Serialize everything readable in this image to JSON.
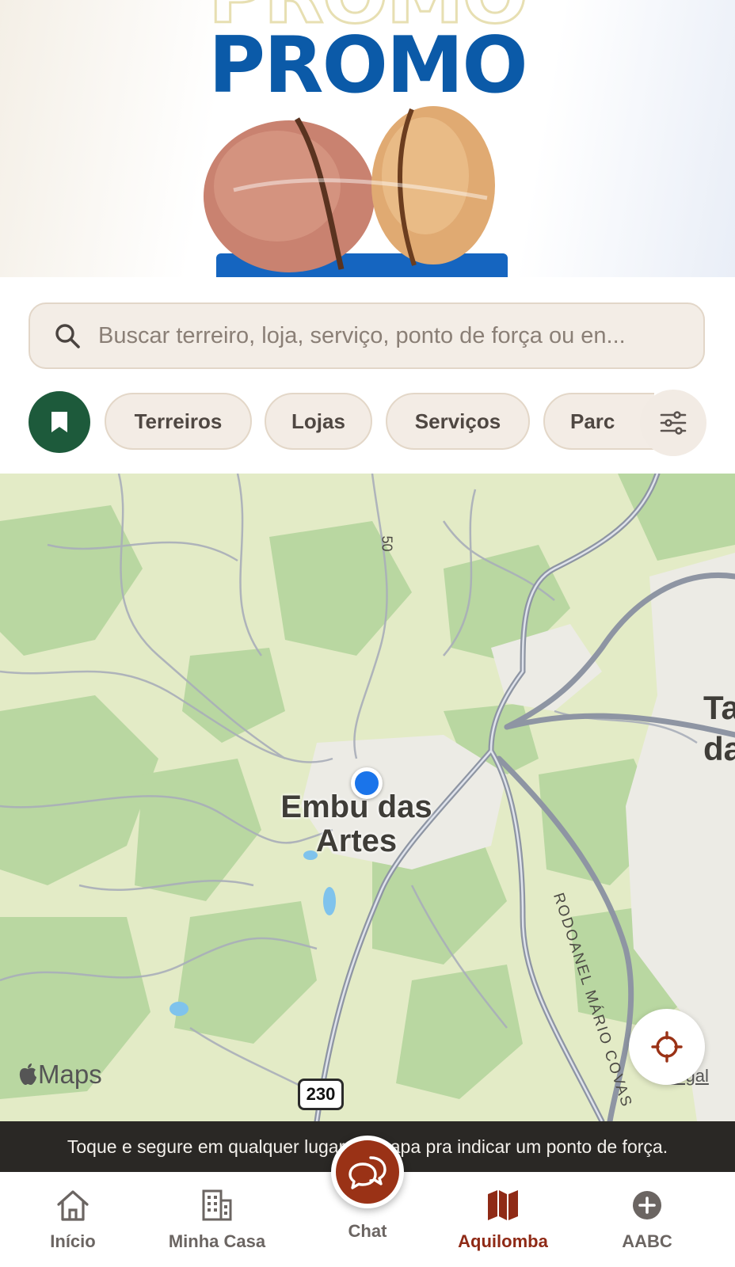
{
  "banner": {
    "headline": "PROMO",
    "headline_color": "#0b5aa8"
  },
  "search": {
    "placeholder": "Buscar terreiro, loja, serviço, ponto de força ou en..."
  },
  "filters": {
    "bookmark_color": "#1d5a3b",
    "chips": [
      "Terreiros",
      "Lojas",
      "Serviços",
      "Parc"
    ]
  },
  "map": {
    "city_label": "Embu das\nArtes",
    "edge_label": "Ta\nda",
    "road_50": "50",
    "road_rodoanel": "RODOANEL MÁRIO COVAS",
    "road_shield": "230",
    "maps_logo": "Maps",
    "legal": "Legal"
  },
  "hint": "Toque e segure em qualquer lugar do mapa pra indicar um ponto de força.",
  "nav": {
    "active_color": "#8f2a16",
    "inicio": "Início",
    "minha_casa": "Minha Casa",
    "chat": "Chat",
    "aquilomba": "Aquilomba",
    "aabc": "AABC"
  }
}
